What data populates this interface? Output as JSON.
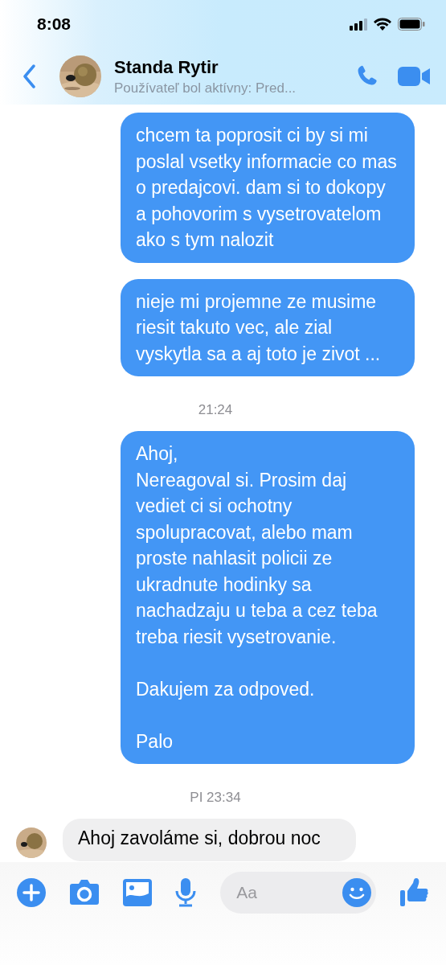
{
  "status_bar": {
    "time": "8:08"
  },
  "header": {
    "name": "Standa Rytir",
    "status": "Používateľ bol aktívny: Pred..."
  },
  "messages": [
    {
      "kind": "outgoing",
      "text": "chcem ta poprosit ci by si mi poslal vsetky informacie co mas o predajcovi. dam si to dokopy a pohovorim s vysetrovatelom ako s tym nalozit"
    },
    {
      "kind": "outgoing",
      "text": "nieje mi projemne ze musime riesit takuto vec, ale zial vyskytla sa a aj toto je zivot ..."
    },
    {
      "kind": "time",
      "text": "21:24"
    },
    {
      "kind": "outgoing",
      "text": "Ahoj,\nNereagoval si. Prosim daj vediet ci si ochotny spolupracovat, alebo mam proste nahlasit policii ze ukradnute hodinky sa nachadzaju u teba a cez teba treba riesit vysetrovanie.\n\nDakujem za odpoved.\n\nPalo"
    },
    {
      "kind": "time",
      "text": "PI 23:34"
    },
    {
      "kind": "incoming",
      "text": "Ahoj zavoláme si, dobrou noc"
    }
  ],
  "composer": {
    "placeholder": "Aa"
  }
}
